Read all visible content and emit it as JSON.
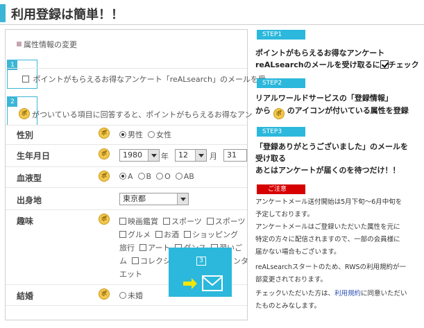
{
  "page": {
    "title": "利用登録は簡単！！"
  },
  "form": {
    "section_title": "属性情報の変更",
    "step1_num": "1",
    "step2_num": "2",
    "step3_num": "3",
    "optin_text": "ポイントがもらえるお得なアンケート「reALsearch」のメールを受",
    "coin_note": "がついている項目に回答すると、ポイントがもらえるお得なアン",
    "gender": {
      "label": "性別",
      "male": "男性",
      "female": "女性"
    },
    "birth": {
      "label": "生年月日",
      "year": "1980",
      "year_unit": "年",
      "month": "12",
      "month_unit": "月",
      "day": "31"
    },
    "blood": {
      "label": "血液型",
      "options": [
        "A",
        "B",
        "O",
        "AB"
      ]
    },
    "birthplace": {
      "label": "出身地",
      "value": "東京都"
    },
    "hobby": {
      "label": "趣味",
      "row1": [
        "映画鑑賞",
        "スポーツ",
        "スポーツ"
      ],
      "row2": [
        "グルメ",
        "お酒",
        "ショッピング"
      ],
      "row3_lead": "旅行",
      "row3": [
        "アート",
        "ダンス",
        "習いご"
      ],
      "row4_lead": "ム",
      "row4": [
        "コレクシ"
      ],
      "row4_tail": "ンタ",
      "row5": "エット"
    },
    "marriage": {
      "label": "結婚",
      "option": "未婚"
    }
  },
  "steps": [
    {
      "badge": "STEP1",
      "line1": "ポイントがもらえるお得なアンケート",
      "line2": "reALsearchのメールを受け取るに",
      "line2_tail": "チェック"
    },
    {
      "badge": "STEP2",
      "line1": "リアルワールドサービスの「登録情報」",
      "line2_pre": "から",
      "line2_post": "のアイコンが付いている属性を登録"
    },
    {
      "badge": "STEP3",
      "line1": "「登録ありがとうございました」のメールを",
      "line2": "受け取る",
      "line3": "あとはアンケートが届くのを待つだけ！！"
    }
  ],
  "notice": {
    "badge": "ご注意",
    "lines": [
      "アンケートメール送付開始は5月下旬〜6月中旬を",
      "予定しております。",
      "アンケートメールはご登録いただいた属性を元に",
      "特定の方々に配信されますので、一部の会員様に",
      "届かない場合もございます。",
      "reALsearchスタートのため、RWSの利用規約が一",
      "部変更されております。"
    ],
    "last_pre": "チェックいただいた方は、",
    "last_link": "利用規約",
    "last_post": "に同意いただい",
    "final": "たものとみなします。"
  },
  "icons": {
    "coin": "ポ"
  },
  "colors": {
    "accent": "#2bb8dc",
    "warning": "#d60000",
    "link": "#2d4fb3"
  }
}
